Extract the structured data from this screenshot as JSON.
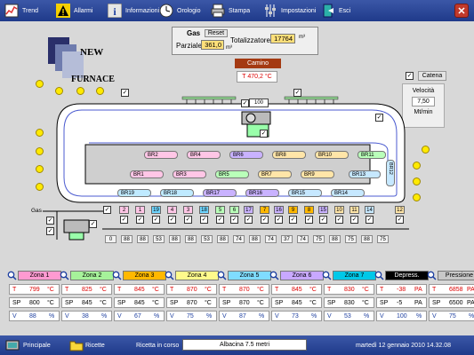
{
  "toolbar": {
    "trend": "Trend",
    "allarmi": "Allarmi",
    "informazioni": "Informazioni",
    "orologio": "Orologio",
    "stampa": "Stampa",
    "impostazioni": "Impostazioni",
    "esci": "Esci",
    "close": "✕"
  },
  "logo": {
    "line1": "NEW",
    "line2": "FURNACE"
  },
  "gas": {
    "title": "Gas",
    "reset_label": "Reset",
    "parziale_label": "Parziale",
    "parziale_value": "361,0",
    "parziale_unit": "m³",
    "totalizzatore_label": "Totalizzatore",
    "totalizzatore_value": "17764",
    "totalizzatore_unit": "m³"
  },
  "camino": {
    "title": "Camino",
    "value": "T  470,2  °C"
  },
  "catena": {
    "title": "Catena",
    "velocita_label": "Velocità",
    "velocita_value": "7,50",
    "unit": "Mt/min"
  },
  "furnace": {
    "burner_value": "100",
    "gas_label": "Gas",
    "burners_top": [
      "BR2",
      "BR4",
      "BR6",
      "BR8",
      "BR10",
      "BR11"
    ],
    "burners_mid": [
      "BR1",
      "BR3",
      "BR5",
      "BR7",
      "BR9",
      "BR13"
    ],
    "burners_bot": [
      "BR19",
      "BR18",
      "BR17",
      "BR16",
      "BR15",
      "BR14"
    ],
    "burner_right": "BR12",
    "zones": [
      "2",
      "1",
      "19",
      "4",
      "3",
      "18",
      "5",
      "6",
      "17",
      "7",
      "16",
      "9",
      "8",
      "15",
      "10",
      "11",
      "14",
      "12"
    ],
    "temps": [
      "0",
      "88",
      "88",
      "53",
      "88",
      "88",
      "53",
      "88",
      "74",
      "88",
      "74",
      "37",
      "74",
      "75",
      "88",
      "75",
      "88",
      "75"
    ]
  },
  "zones": [
    {
      "name": "Zona 1",
      "t": "799",
      "sp": "800",
      "v": "88",
      "color": "#ff9ad1",
      "unit_t": "°C",
      "unit_v": "%"
    },
    {
      "name": "Zona 2",
      "t": "825",
      "sp": "845",
      "v": "38",
      "color": "#a6f29a",
      "unit_t": "°C",
      "unit_v": "%"
    },
    {
      "name": "Zona 3",
      "t": "845",
      "sp": "845",
      "v": "67",
      "color": "#ffb800",
      "unit_t": "°C",
      "unit_v": "%"
    },
    {
      "name": "Zona 4",
      "t": "870",
      "sp": "870",
      "v": "75",
      "color": "#fffa8c",
      "unit_t": "°C",
      "unit_v": "%"
    },
    {
      "name": "Zona 5",
      "t": "870",
      "sp": "870",
      "v": "87",
      "color": "#7fdcff",
      "unit_t": "°C",
      "unit_v": "%"
    },
    {
      "name": "Zona 6",
      "t": "845",
      "sp": "845",
      "v": "73",
      "color": "#c8a8ff",
      "unit_t": "°C",
      "unit_v": "%"
    },
    {
      "name": "Zona 7",
      "t": "830",
      "sp": "830",
      "v": "53",
      "color": "#00c8e8",
      "unit_t": "°C",
      "unit_v": "%"
    },
    {
      "name": "Depress.",
      "t": "-38",
      "sp": "-5",
      "v": "100",
      "color": "#000000",
      "unit_t": "PA",
      "unit_v": "%"
    },
    {
      "name": "Pressione",
      "t": "6858",
      "sp": "6500",
      "v": "75",
      "color": "#c8c8c8",
      "unit_t": "PA",
      "unit_v": "%"
    }
  ],
  "labels": {
    "t": "T",
    "sp": "SP",
    "v": "V"
  },
  "bottom": {
    "principale": "Principale",
    "ricette": "Ricette",
    "ricetta_label": "Ricetta in corso",
    "ricetta_value": "Albacina 7.5 metri",
    "datetime": "martedì 12 gennaio 2010  14.32.08"
  },
  "colors": {
    "toolbar": "#2a46a0",
    "zone_hdr_text_dark": "#ffffff"
  }
}
